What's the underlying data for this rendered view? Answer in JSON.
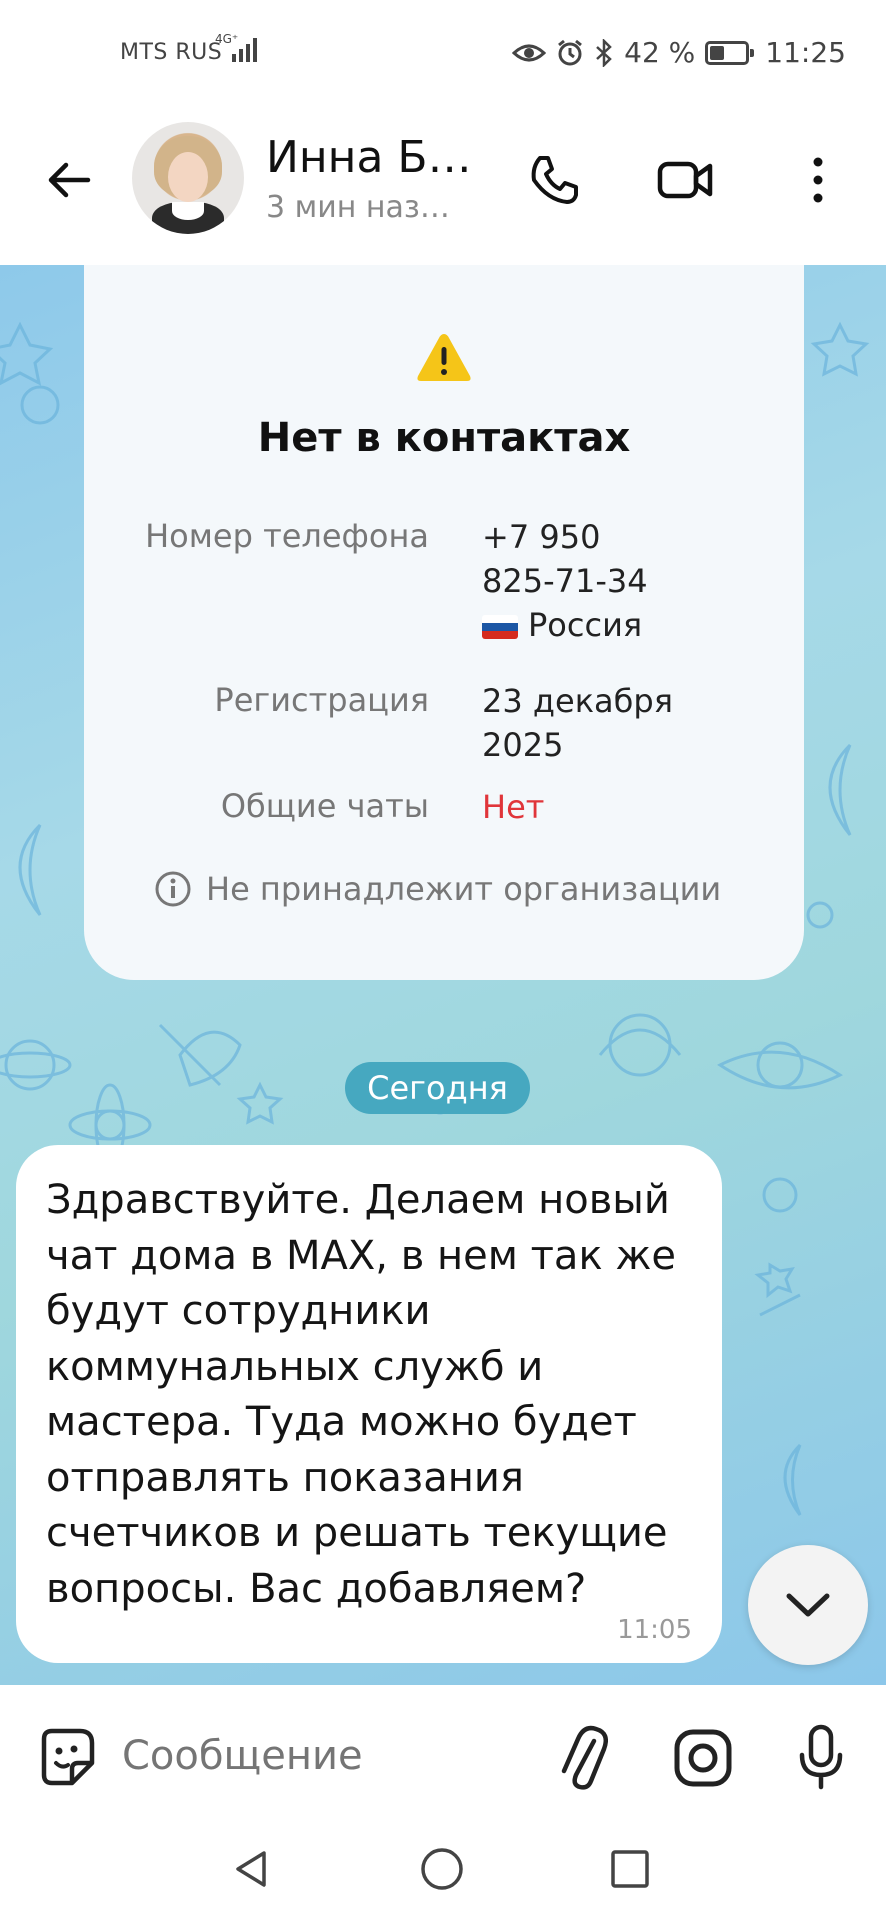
{
  "status_bar": {
    "carrier": "MTS RUS",
    "network": "4G⁺",
    "battery_text": "42 %",
    "battery_level": 0.42,
    "time": "11:25"
  },
  "header": {
    "name": "Инна Б…",
    "last_seen": "3 мин наз…"
  },
  "contact_card": {
    "title": "Нет в контактах",
    "phone_label": "Номер телефона",
    "phone_line1": "+7 950",
    "phone_line2": "825-71-34",
    "country": "Россия",
    "registration_label": "Регистрация",
    "registration_line1": "23 декабря",
    "registration_line2": "2025",
    "common_chats_label": "Общие чаты",
    "common_chats_value": "Нет",
    "org_note": "Не принадлежит организации"
  },
  "chat": {
    "date_separator": "Сегодня",
    "message": {
      "lines": [
        "Здравствуйте. Делаем новый",
        "чат дома в MAX, в нем так же",
        "будут сотрудники",
        "коммунальных служб и",
        "мастера. Туда можно будет",
        "отправлять показания",
        "счетчиков и решать текущие",
        "вопросы. Вас добавляем?"
      ],
      "time": "11:05"
    }
  },
  "composer": {
    "placeholder": "Сообщение"
  },
  "colors": {
    "accent": "#46a8c0",
    "warning": "#f5c518",
    "danger": "#e0353a"
  }
}
